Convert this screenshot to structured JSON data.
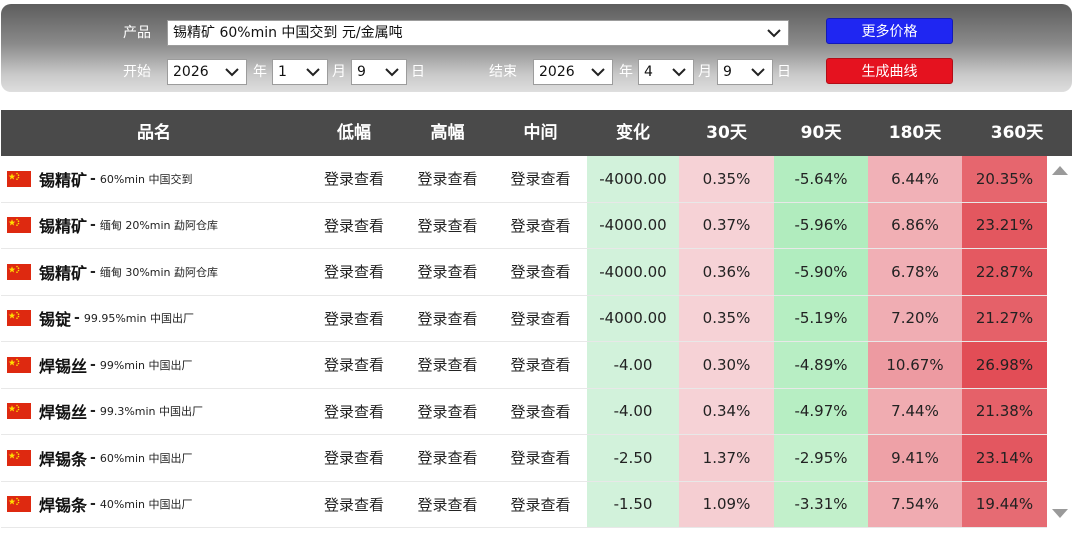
{
  "filters": {
    "product_label": "产品",
    "product_value": "锡精矿 60%min 中国交到 元/金属吨",
    "start_label": "开始",
    "end_label": "结束",
    "year_unit": "年",
    "month_unit": "月",
    "day_unit": "日",
    "start": {
      "year": "2026",
      "month": "1",
      "day": "9"
    },
    "end": {
      "year": "2026",
      "month": "4",
      "day": "9"
    },
    "more_prices_label": "更多价格",
    "generate_chart_label": "生成曲线"
  },
  "table": {
    "headers": [
      "品名",
      "低幅",
      "高幅",
      "中间",
      "变化",
      "30天",
      "90天",
      "180天",
      "360天"
    ],
    "rows": [
      {
        "name": "锡精矿",
        "desc": "60%min 中国交到",
        "low": "登录查看",
        "high": "登录查看",
        "mid": "登录查看",
        "change": "-4000.00",
        "d30": "0.35%",
        "d90": "-5.64%",
        "d180": "6.44%",
        "d360": "20.35%"
      },
      {
        "name": "锡精矿",
        "desc": "缅甸 20%min 勐阿仓库",
        "low": "登录查看",
        "high": "登录查看",
        "mid": "登录查看",
        "change": "-4000.00",
        "d30": "0.37%",
        "d90": "-5.96%",
        "d180": "6.86%",
        "d360": "23.21%"
      },
      {
        "name": "锡精矿",
        "desc": "缅甸 30%min 勐阿仓库",
        "low": "登录查看",
        "high": "登录查看",
        "mid": "登录查看",
        "change": "-4000.00",
        "d30": "0.36%",
        "d90": "-5.90%",
        "d180": "6.78%",
        "d360": "22.87%"
      },
      {
        "name": "锡锭",
        "desc": "99.95%min 中国出厂",
        "low": "登录查看",
        "high": "登录查看",
        "mid": "登录查看",
        "change": "-4000.00",
        "d30": "0.35%",
        "d90": "-5.19%",
        "d180": "7.20%",
        "d360": "21.27%"
      },
      {
        "name": "焊锡丝",
        "desc": "99%min 中国出厂",
        "low": "登录查看",
        "high": "登录查看",
        "mid": "登录查看",
        "change": "-4.00",
        "d30": "0.30%",
        "d90": "-4.89%",
        "d180": "10.67%",
        "d360": "26.98%"
      },
      {
        "name": "焊锡丝",
        "desc": "99.3%min 中国出厂",
        "low": "登录查看",
        "high": "登录查看",
        "mid": "登录查看",
        "change": "-4.00",
        "d30": "0.34%",
        "d90": "-4.97%",
        "d180": "7.44%",
        "d360": "21.38%"
      },
      {
        "name": "焊锡条",
        "desc": "60%min 中国出厂",
        "low": "登录查看",
        "high": "登录查看",
        "mid": "登录查看",
        "change": "-2.50",
        "d30": "1.37%",
        "d90": "-2.95%",
        "d180": "9.41%",
        "d360": "23.14%"
      },
      {
        "name": "焊锡条",
        "desc": "40%min 中国出厂",
        "low": "登录查看",
        "high": "登录查看",
        "mid": "登录查看",
        "change": "-1.50",
        "d30": "1.09%",
        "d90": "-3.31%",
        "d180": "7.54%",
        "d360": "19.44%"
      }
    ]
  },
  "colors": {
    "header_bg": "#4a4a4a",
    "change_bg": "#d2f2db",
    "button_blue": "#1f26f2",
    "button_red": "#e5121f",
    "flag_red": "#de2910",
    "flag_star": "#ffde00"
  },
  "icons": {
    "flag": "china-flag-icon",
    "select_arrow": "chevron-down-icon",
    "scroll_up": "scroll-up-arrow-icon",
    "scroll_down": "scroll-down-arrow-icon"
  }
}
